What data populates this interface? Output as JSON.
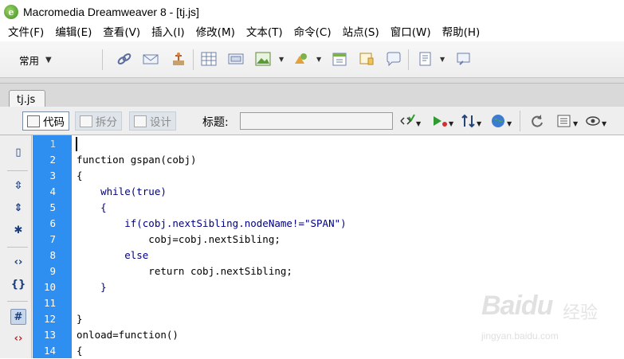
{
  "window": {
    "title": "Macromedia Dreamweaver 8 - [tj.js]",
    "logo_letter": "e"
  },
  "menu": [
    "文件(F)",
    "编辑(E)",
    "查看(V)",
    "插入(I)",
    "修改(M)",
    "文本(T)",
    "命令(C)",
    "站点(S)",
    "窗口(W)",
    "帮助(H)"
  ],
  "insert_toolbar": {
    "category": "常用",
    "icons": [
      "hyperlink-icon",
      "email-link-icon",
      "named-anchor-icon",
      "table-icon",
      "layer-icon",
      "image-icon",
      "media-icon",
      "date-icon",
      "comment-icon",
      "template-icon",
      "tag-chooser-icon"
    ]
  },
  "document": {
    "tab": "tj.js",
    "view_buttons": {
      "code": "代码",
      "split": "拆分",
      "design": "设计"
    },
    "title_label": "标题:",
    "title_value": ""
  },
  "editor": {
    "line_numbers": [
      "1",
      "2",
      "3",
      "4",
      "5",
      "6",
      "7",
      "8",
      "9",
      "10",
      "11",
      "12",
      "13",
      "14"
    ],
    "lines": [
      "",
      "function gspan(cobj)",
      "{",
      "    while(true)",
      "    {",
      "        if(cobj.nextSibling.nodeName!=\"SPAN\")",
      "            cobj=cobj.nextSibling;",
      "        else",
      "            return cobj.nextSibling;",
      "    }",
      "",
      "}",
      "onload=function()",
      "{"
    ]
  },
  "watermark": {
    "brand": "Baidu",
    "cn": "经验",
    "url": "jingyan.baidu.com"
  },
  "colors": {
    "linenumber_band": "#2f8ff0",
    "keyword": "#000080",
    "toolbar_bg": "#eeeeee"
  }
}
